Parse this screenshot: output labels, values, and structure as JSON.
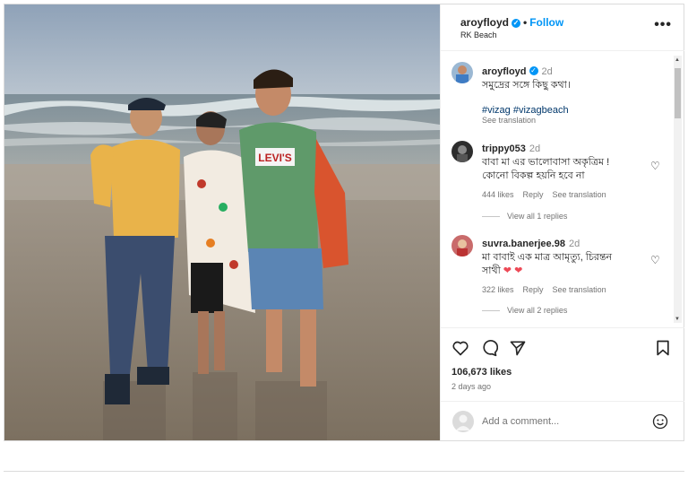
{
  "post": {
    "username": "aroyfloyd",
    "follow_label": "Follow",
    "location": "RK Beach",
    "separator": "•",
    "more_label": "•••"
  },
  "caption": {
    "username": "aroyfloyd",
    "time": "2d",
    "text": "সমুদ্রের সঙ্গে কিছু কথা।",
    "hashtags": "#vizag #vizagbeach",
    "see_translation": "See translation"
  },
  "comments": [
    {
      "username": "trippy053",
      "time": "2d",
      "text_line1": "বাবা মা এর ভালোবাসা অকৃত্রিম !",
      "text_line2": "কোনো বিকল্প হয়নি হবে না",
      "likes": "444 likes",
      "reply": "Reply",
      "see_translation": "See translation",
      "view_replies": "View all 1 replies"
    },
    {
      "username": "suvra.banerjee.98",
      "time": "2d",
      "text_line1": "মা বাবাই এক মাত্র আমৃত্যু, চিরন্তন",
      "text_line2": "সাথী",
      "hearts": "❤ ❤",
      "likes": "322 likes",
      "reply": "Reply",
      "see_translation": "See translation",
      "view_replies": "View all 2 replies"
    }
  ],
  "stats": {
    "likes": "106,673 likes",
    "ago": "2 days ago"
  },
  "add_comment": {
    "placeholder": "Add a comment..."
  },
  "icons": {
    "verified": "✓",
    "heart_outline": "♡",
    "scroll_up": "▲",
    "scroll_down": "▼"
  },
  "colors": {
    "accent": "#0095f6",
    "hashtag": "#00376b",
    "heart": "#ed4956"
  }
}
